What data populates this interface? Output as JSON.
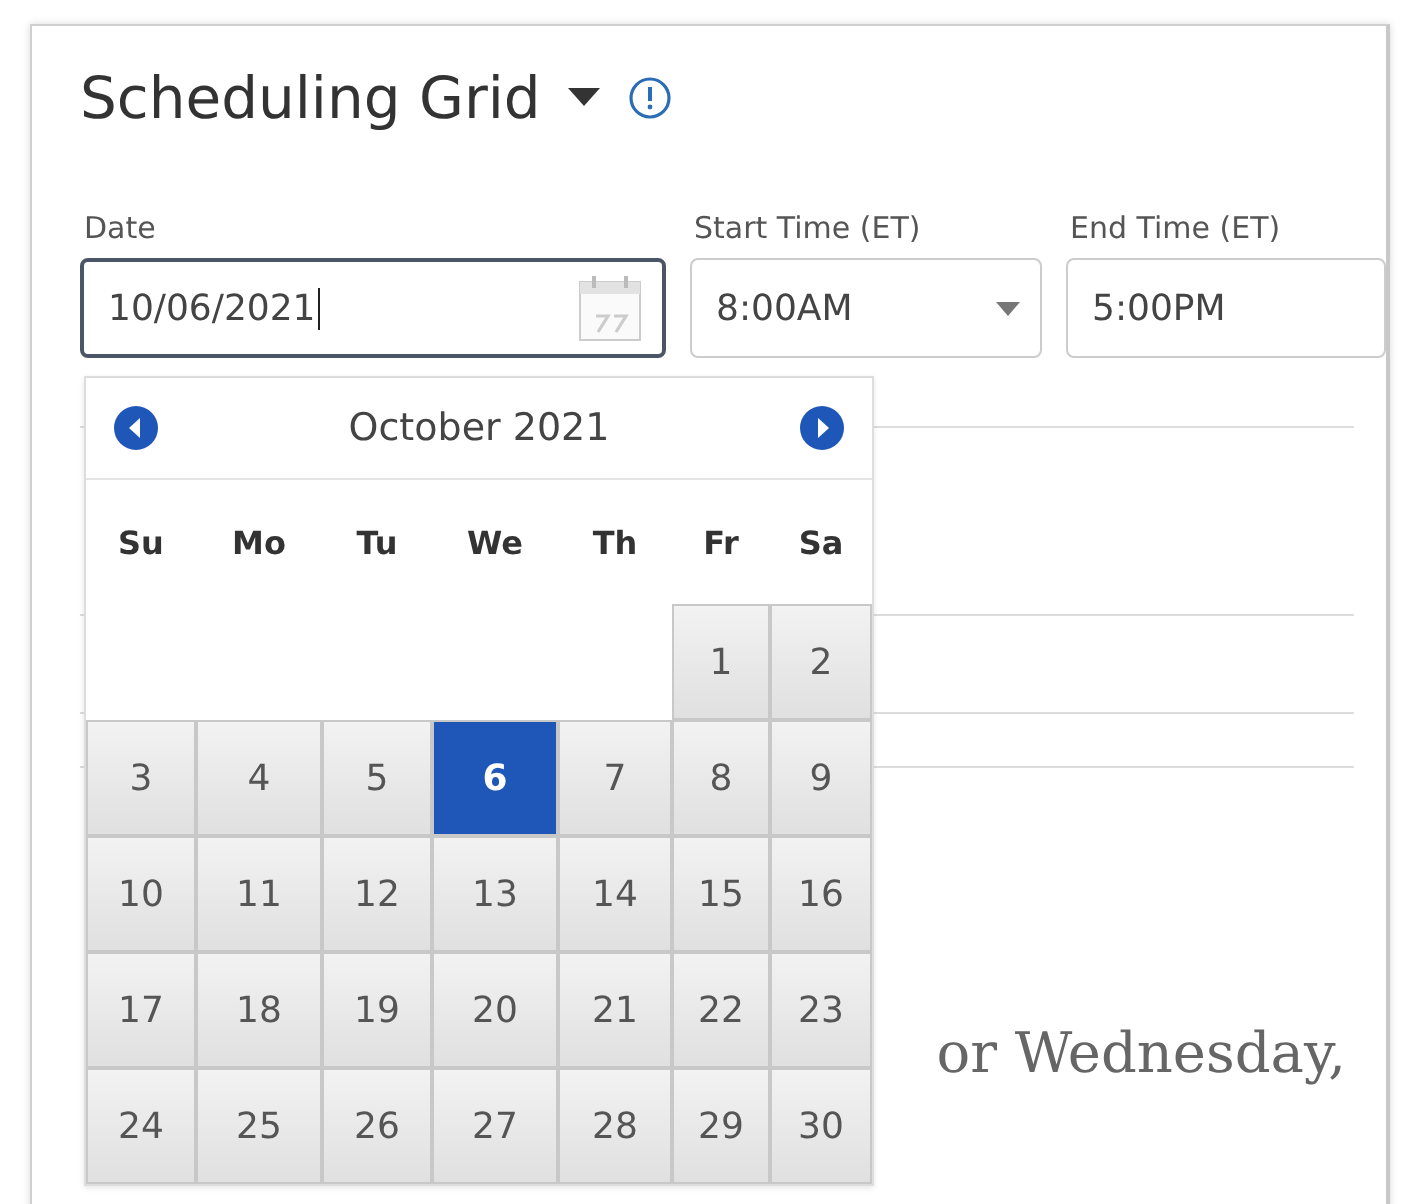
{
  "header": {
    "title": "Scheduling Grid"
  },
  "fields": [
    {
      "kind": "date",
      "label": "Date",
      "value": "10/06/2021",
      "focused": true
    },
    {
      "kind": "select",
      "label": "Start Time (ET)",
      "value": "8:00AM",
      "focused": false
    },
    {
      "kind": "text",
      "label": "End Time (ET)",
      "value": "5:00PM",
      "focused": false
    }
  ],
  "calendar": {
    "month": "October 2021",
    "weekdays": [
      "Su",
      "Mo",
      "Tu",
      "We",
      "Th",
      "Fr",
      "Sa"
    ],
    "weeks": [
      [
        {
          "day": "1",
          "selected": false
        },
        {
          "day": "2",
          "selected": false
        }
      ],
      [
        {
          "day": "3",
          "selected": false
        },
        {
          "day": "4",
          "selected": false
        },
        {
          "day": "5",
          "selected": false
        },
        {
          "day": "6",
          "selected": true
        },
        {
          "day": "7",
          "selected": false
        },
        {
          "day": "8",
          "selected": false
        },
        {
          "day": "9",
          "selected": false
        }
      ],
      [
        {
          "day": "10",
          "selected": false
        },
        {
          "day": "11",
          "selected": false
        },
        {
          "day": "12",
          "selected": false
        },
        {
          "day": "13",
          "selected": false
        },
        {
          "day": "14",
          "selected": false
        },
        {
          "day": "15",
          "selected": false
        },
        {
          "day": "16",
          "selected": false
        }
      ],
      [
        {
          "day": "17",
          "selected": false
        },
        {
          "day": "18",
          "selected": false
        },
        {
          "day": "19",
          "selected": false
        },
        {
          "day": "20",
          "selected": false
        },
        {
          "day": "21",
          "selected": false
        },
        {
          "day": "22",
          "selected": false
        },
        {
          "day": "23",
          "selected": false
        }
      ],
      [
        {
          "day": "24",
          "selected": false
        },
        {
          "day": "25",
          "selected": false
        },
        {
          "day": "26",
          "selected": false
        },
        {
          "day": "27",
          "selected": false
        },
        {
          "day": "28",
          "selected": false
        },
        {
          "day": "29",
          "selected": false
        },
        {
          "day": "30",
          "selected": false
        }
      ]
    ]
  },
  "heading_fragment": "or Wednesday,"
}
